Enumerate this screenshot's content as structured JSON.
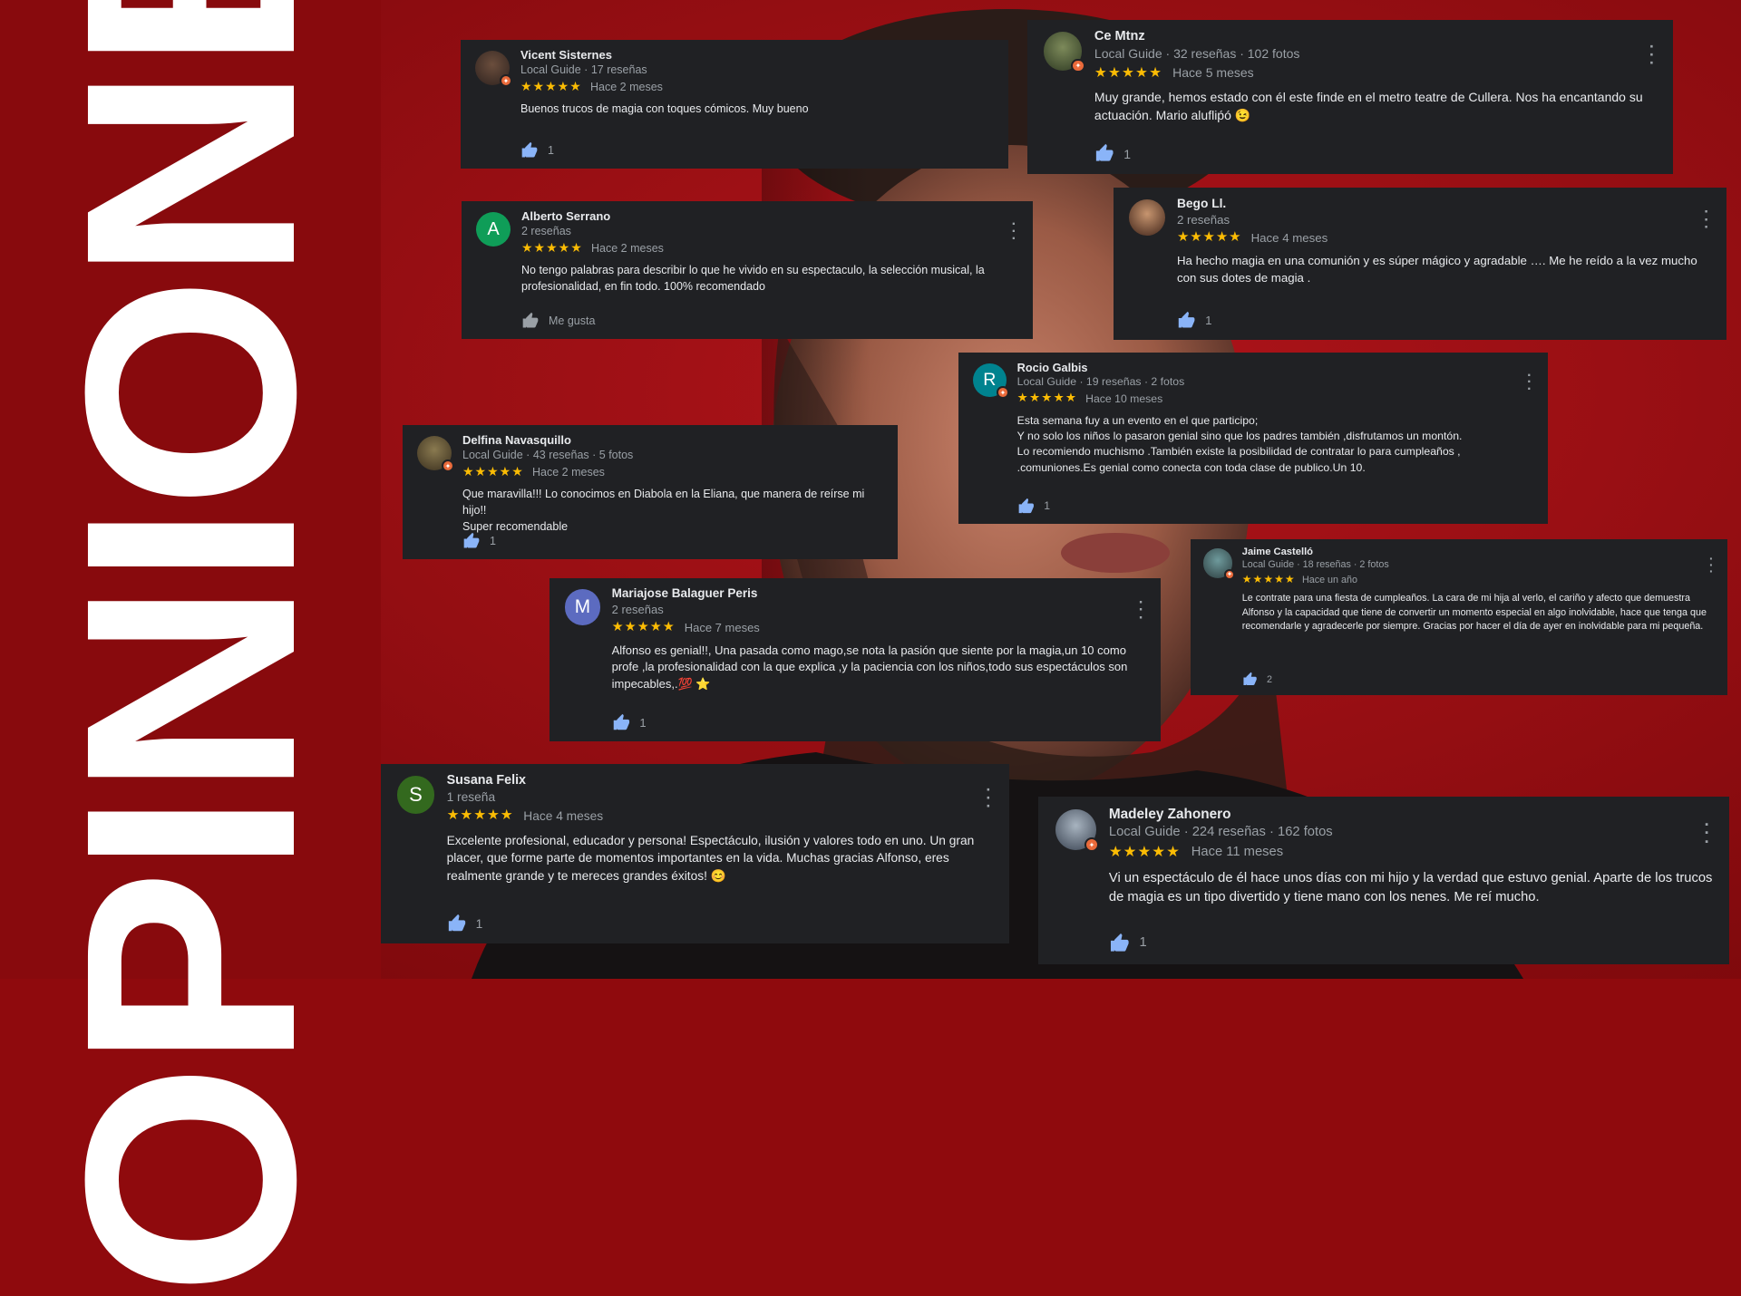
{
  "title": "OPINIONES",
  "colors": {
    "background": "#8f0a0d",
    "card": "#202124",
    "star": "#fbbc04",
    "like": "#8ab4f8"
  },
  "reviews": [
    {
      "name": "Vicent Sisternes",
      "meta": "Local Guide · 17 reseñas",
      "stars": "★★★★★",
      "ago": "Hace 2 meses",
      "text": "Buenos trucos de magia con toques cómicos. Muy bueno",
      "likes": "1"
    },
    {
      "name": "Ce Mtnz",
      "meta": "Local Guide · 32 reseñas · 102 fotos",
      "stars": "★★★★★",
      "ago": "Hace 5 meses",
      "text": "Muy grande, hemos estado con él este finde en el metro teatre de Cullera. Nos ha encantando su actuación. Mario alufliṕó 😉",
      "likes": "1"
    },
    {
      "name": "Alberto Serrano",
      "initial": "A",
      "meta": "2 reseñas",
      "stars": "★★★★★",
      "ago": "Hace 2 meses",
      "text": "No tengo palabras para describir lo que he vivido en su espectaculo, la selección musical, la profesionalidad, en fin todo. 100% recomendado",
      "likes": "Me gusta"
    },
    {
      "name": "Bego Ll.",
      "meta": "2 reseñas",
      "stars": "★★★★★",
      "ago": "Hace 4 meses",
      "text": "Ha hecho magia en una comunión y es súper mágico y agradable …. Me he reído a la vez mucho con sus dotes de magia .",
      "likes": "1"
    },
    {
      "name": "Rocio Galbis",
      "initial": "R",
      "meta": "Local Guide · 19 reseñas · 2 fotos",
      "stars": "★★★★★",
      "ago": "Hace 10 meses",
      "text": "Esta semana fuy a un evento en el que participo;\nY no solo los niños lo pasaron genial sino que los padres también ,disfrutamos un montón.\nLo recomiendo muchismo .También existe la posibilidad de contratar lo para cumpleaños ,\n.comuniones.Es genial como conecta con toda clase de publico.Un 10.",
      "likes": "1"
    },
    {
      "name": "Delfina Navasquillo",
      "meta": "Local Guide · 43 reseñas · 5 fotos",
      "stars": "★★★★★",
      "ago": "Hace 2 meses",
      "text": "Que maravilla!!! Lo conocimos en Diabola en la Eliana, que manera de reírse mi hijo!!\nSuper recomendable",
      "likes": "1"
    },
    {
      "name": "Jaime Castelló",
      "meta": "Local Guide · 18 reseñas · 2 fotos",
      "stars": "★★★★★",
      "ago": "Hace un año",
      "text": "Le contrate para una fiesta de cumpleaños. La cara de mi hija al verlo, el cariño y afecto que demuestra Alfonso y la capacidad que tiene de convertir un momento especial en algo inolvidable, hace que tenga que recomendarle y agradecerle por siempre. Gracias por hacer el día de ayer en inolvidable para mi pequeña.",
      "likes": "2"
    },
    {
      "name": "Mariajose Balaguer Peris",
      "initial": "M",
      "meta": "2 reseñas",
      "stars": "★★★★★",
      "ago": "Hace 7 meses",
      "text": "Alfonso es genial!!, Una pasada como mago,se nota la pasión que siente por la magia,un 10 como profe ,la profesionalidad con la que explica ,y la paciencia con los niños,todo sus espectáculos son impecables,.💯 ⭐",
      "likes": "1"
    },
    {
      "name": "Susana Felix",
      "initial": "S",
      "meta": "1 reseña",
      "stars": "★★★★★",
      "ago": "Hace 4 meses",
      "text": "Excelente profesional, educador y persona! Espectáculo, ilusión y valores todo en uno. Un gran placer, que forme parte de momentos importantes en la vida. Muchas gracias Alfonso, eres realmente grande y te mereces grandes éxitos! 😊",
      "likes": "1"
    },
    {
      "name": "Madeley Zahonero",
      "meta": "Local Guide · 224 reseñas · 162 fotos",
      "stars": "★★★★★",
      "ago": "Hace 11 meses",
      "text": "Vi un espectáculo de él hace unos días con mi hijo y la verdad que estuvo genial. Aparte de los trucos de magia es un tipo divertido y tiene mano con los nenes. Me reí mucho.",
      "likes": "1"
    }
  ]
}
